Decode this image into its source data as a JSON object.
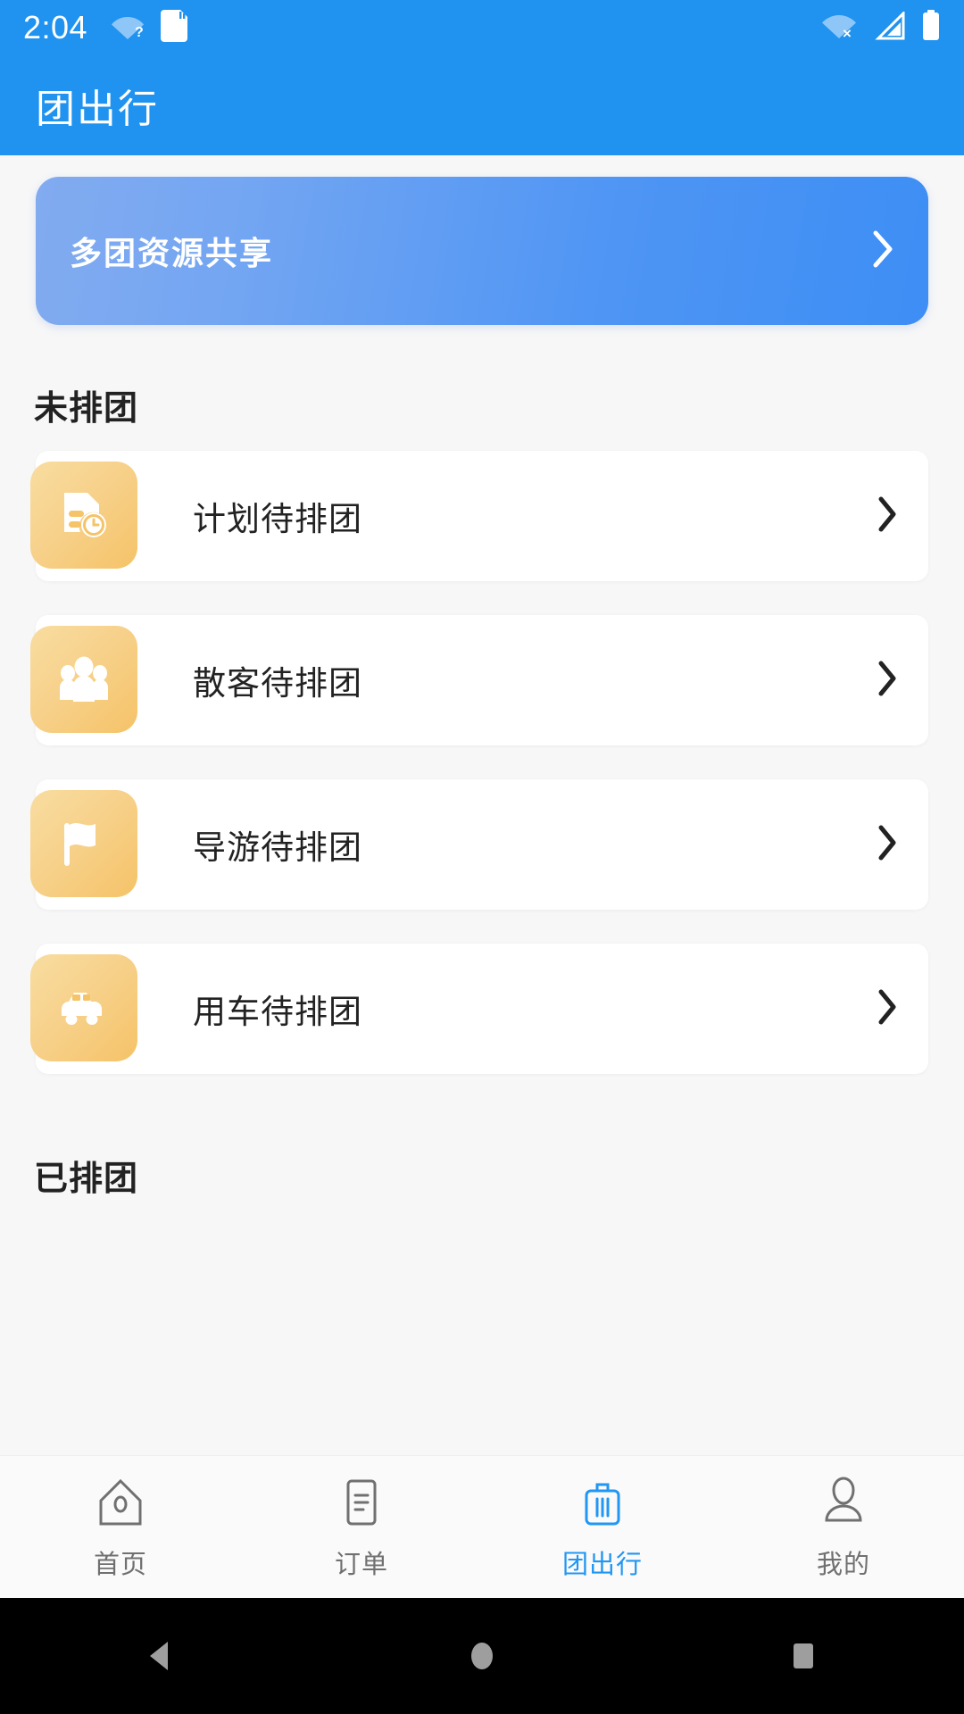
{
  "status_bar": {
    "time": "2:04",
    "left_icons": [
      "wifi-question-icon",
      "sd-card-icon"
    ],
    "right_icons": [
      "wifi-off-icon",
      "cellular-no-signal-icon",
      "battery-full-icon"
    ]
  },
  "app_bar": {
    "title": "团出行",
    "background_color": "#1f93ef"
  },
  "banner": {
    "title": "多团资源共享",
    "arrow_icon": "chevron-right-icon",
    "gradient_from": "#82abf0",
    "gradient_to": "#3d8ef5"
  },
  "sections": [
    {
      "title": "未排团",
      "items": [
        {
          "label": "计划待排团",
          "icon": "document-clock-icon",
          "arrow_icon": "chevron-right-icon"
        },
        {
          "label": "散客待排团",
          "icon": "people-group-icon",
          "arrow_icon": "chevron-right-icon"
        },
        {
          "label": "导游待排团",
          "icon": "flag-icon",
          "arrow_icon": "chevron-right-icon"
        },
        {
          "label": "用车待排团",
          "icon": "car-icon",
          "arrow_icon": "chevron-right-icon"
        }
      ]
    },
    {
      "title": "已排团",
      "items": []
    }
  ],
  "tab_bar": {
    "active_color": "#2196f3",
    "inactive_color": "#707070",
    "tabs": [
      {
        "label": "首页",
        "icon": "home-icon",
        "active": false
      },
      {
        "label": "订单",
        "icon": "order-list-icon",
        "active": false
      },
      {
        "label": "团出行",
        "icon": "suitcase-icon",
        "active": true
      },
      {
        "label": "我的",
        "icon": "person-icon",
        "active": false
      }
    ]
  },
  "android_nav": {
    "buttons": [
      {
        "icon": "back-triangle-icon"
      },
      {
        "icon": "home-circle-icon"
      },
      {
        "icon": "recents-square-icon"
      }
    ]
  },
  "icon_tile": {
    "gradient_from": "#f8dda0",
    "gradient_to": "#f5c368"
  }
}
